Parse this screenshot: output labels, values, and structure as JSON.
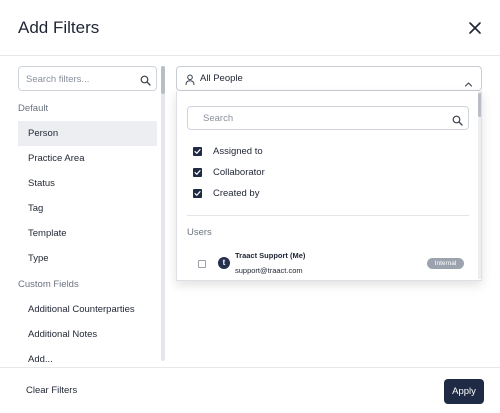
{
  "dialog": {
    "title": "Add Filters"
  },
  "sidebar": {
    "search_placeholder": "Search filters...",
    "default_label": "Default",
    "default_items": [
      "Person",
      "Practice Area",
      "Status",
      "Tag",
      "Template",
      "Type"
    ],
    "custom_label": "Custom Fields",
    "custom_items": [
      "Additional Counterparties",
      "Additional Notes",
      "Add..."
    ]
  },
  "person_select": {
    "value": "All People",
    "dropdown": {
      "search_placeholder": "Search",
      "options": [
        {
          "label": "Assigned to",
          "checked": true
        },
        {
          "label": "Collaborator",
          "checked": true
        },
        {
          "label": "Created by",
          "checked": true
        }
      ],
      "users_label": "Users",
      "users": [
        {
          "avatar": "t",
          "name": "Traact Support (Me)",
          "email": "support@traact.com",
          "badge": "Internal",
          "checked": false
        }
      ]
    }
  },
  "footer": {
    "clear_label": "Clear Filters",
    "apply_label": "Apply"
  },
  "colors": {
    "primary": "#1f2a44",
    "active_row": "#eceef1",
    "badge": "#9ca3af"
  }
}
